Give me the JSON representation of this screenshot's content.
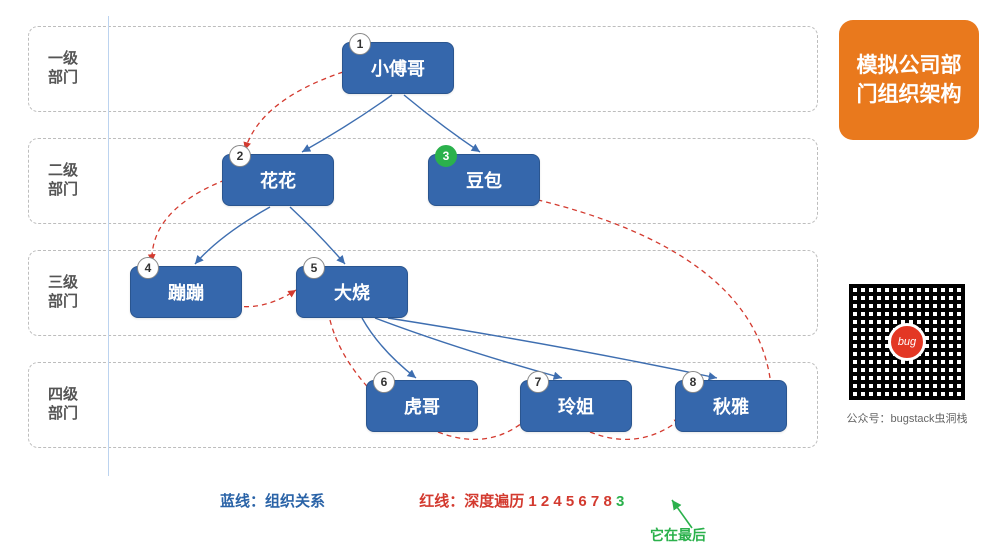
{
  "levels": [
    {
      "label": "一级\n部门"
    },
    {
      "label": "二级\n部门"
    },
    {
      "label": "三级\n部门"
    },
    {
      "label": "四级\n部门"
    }
  ],
  "nodes": {
    "n1": {
      "num": "1",
      "name": "小傅哥"
    },
    "n2": {
      "num": "2",
      "name": "花花"
    },
    "n3": {
      "num": "3",
      "name": "豆包"
    },
    "n4": {
      "num": "4",
      "name": "蹦蹦"
    },
    "n5": {
      "num": "5",
      "name": "大烧"
    },
    "n6": {
      "num": "6",
      "name": "虎哥"
    },
    "n7": {
      "num": "7",
      "name": "玲姐"
    },
    "n8": {
      "num": "8",
      "name": "秋雅"
    }
  },
  "title_card": "模拟公司部门组织架构",
  "qr_caption": "公众号：bugstack虫洞栈",
  "legend": {
    "blue_label": "蓝线：",
    "blue_text": "组织关系",
    "red_label": "红线：",
    "red_text": "深度遍历 1 2 4 5 6 7 8 ",
    "red_last": "3"
  },
  "footnote": "它在最后",
  "chart_data": {
    "type": "tree",
    "title": "模拟公司部门组织架构",
    "levels": [
      "一级部门",
      "二级部门",
      "三级部门",
      "四级部门"
    ],
    "nodes": [
      {
        "id": 1,
        "name": "小傅哥",
        "level": 1,
        "parent": null
      },
      {
        "id": 2,
        "name": "花花",
        "level": 2,
        "parent": 1
      },
      {
        "id": 3,
        "name": "豆包",
        "level": 2,
        "parent": 1
      },
      {
        "id": 4,
        "name": "蹦蹦",
        "level": 3,
        "parent": 2
      },
      {
        "id": 5,
        "name": "大烧",
        "level": 3,
        "parent": 2
      },
      {
        "id": 6,
        "name": "虎哥",
        "level": 4,
        "parent": 5
      },
      {
        "id": 7,
        "name": "玲姐",
        "level": 4,
        "parent": 5
      },
      {
        "id": 8,
        "name": "秋雅",
        "level": 4,
        "parent": 5
      }
    ],
    "blue_edges_meaning": "组织关系",
    "red_path_meaning": "深度遍历",
    "dfs_order": [
      1,
      2,
      4,
      5,
      6,
      7,
      8,
      3
    ],
    "highlight_last": 3
  }
}
